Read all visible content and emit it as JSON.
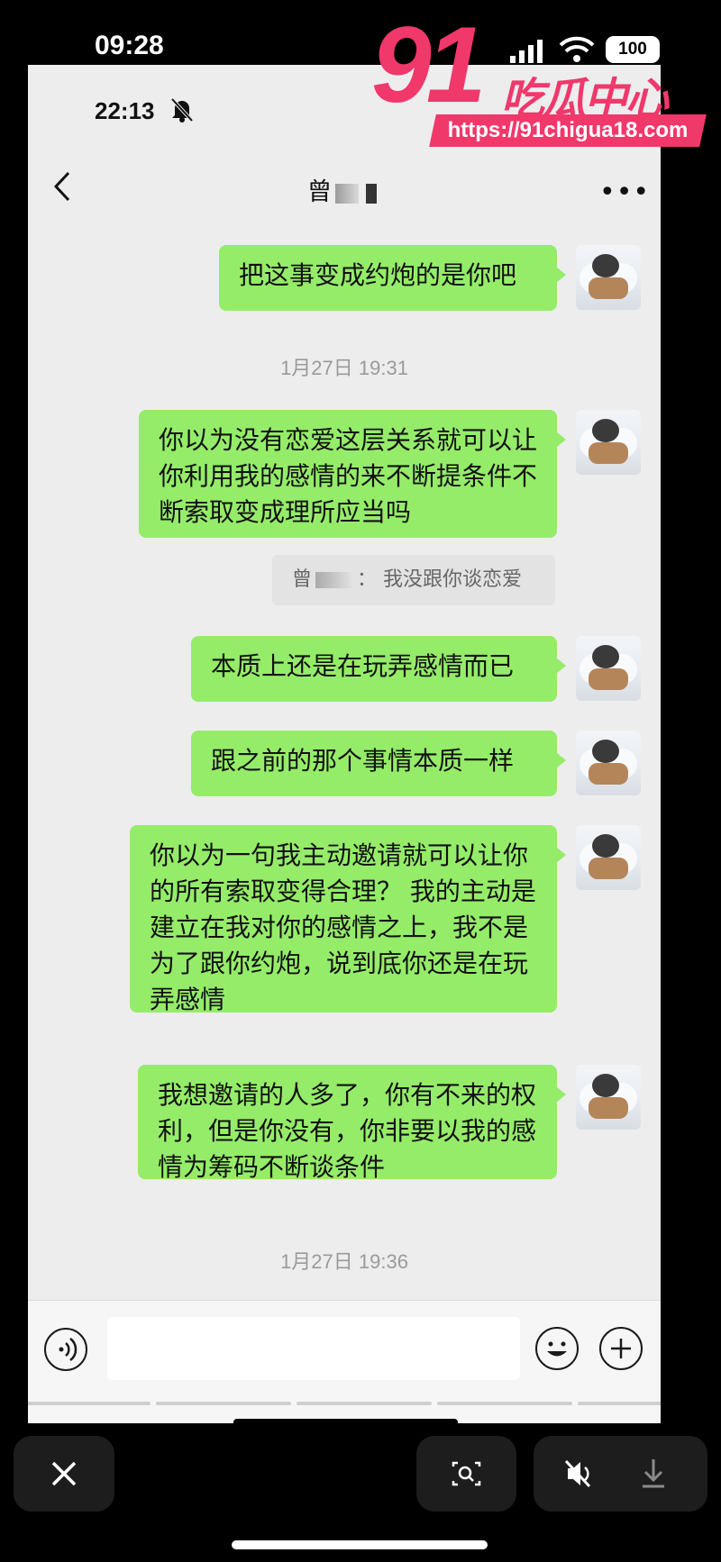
{
  "outer_status": {
    "time": "09:28",
    "battery": "100"
  },
  "watermark": {
    "number": "91",
    "text": "吃瓜中心",
    "url": "https://91chigua18.com"
  },
  "inner_status": {
    "time": "22:13"
  },
  "chat": {
    "contact_name": "曾",
    "messages": [
      {
        "text": "把这事变成约炮的是你吧"
      },
      {
        "timestamp": "1月27日 19:31"
      },
      {
        "text": "你以为没有恋爱这层关系就可以让你利用我的感情的来不断提条件不断索取变成理所应当吗"
      },
      {
        "quote_name": "曾",
        "quote_text": "：   我没跟你谈恋爱"
      },
      {
        "text": "本质上还是在玩弄感情而已"
      },
      {
        "text": "跟之前的那个事情本质一样"
      },
      {
        "text": "你以为一句我主动邀请就可以让你的所有索取变得合理？ 我的主动是建立在我对你的感情之上，我不是为了跟你约炮，说到底你还是在玩弄感情"
      },
      {
        "text": "我想邀请的人多了，你有不来的权利，但是你没有，你非要以我的感情为筹码不断谈条件"
      },
      {
        "timestamp": "1月27日 19:36"
      }
    ]
  },
  "colors": {
    "bubble": "#95ec69",
    "chat_bg": "#ededed",
    "watermark": "#f0386b"
  }
}
